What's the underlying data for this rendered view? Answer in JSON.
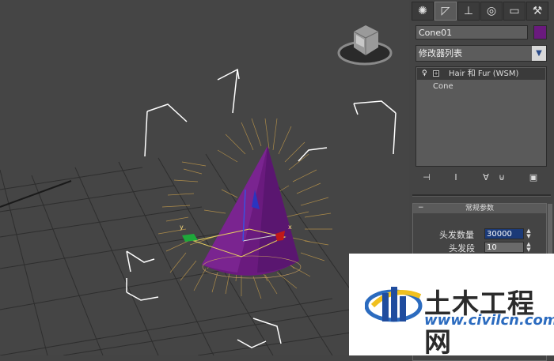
{
  "command_panel": {
    "tabs": [
      {
        "icon": "create-icon"
      },
      {
        "icon": "modify-icon"
      },
      {
        "icon": "hierarchy-icon"
      },
      {
        "icon": "motion-icon"
      },
      {
        "icon": "display-icon"
      },
      {
        "icon": "utilities-icon"
      }
    ],
    "object_name": "Cone01",
    "object_color": "#6a1a7e",
    "modifier_list_label": "修改器列表",
    "stack": [
      {
        "label": "Hair 和 Fur (WSM)"
      },
      {
        "label": "Cone"
      }
    ],
    "rollout_title": "常规参数",
    "params": [
      {
        "label": "头发数量",
        "value": "30000"
      },
      {
        "label": "头发段",
        "value": "10"
      }
    ]
  },
  "viewport": {
    "axis_labels": {
      "x": "x",
      "y": "y"
    }
  },
  "watermark": {
    "title": "土木工程网",
    "url": "www.civilcn.com"
  }
}
